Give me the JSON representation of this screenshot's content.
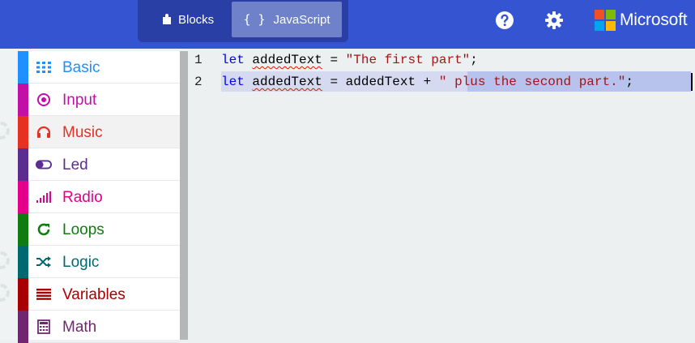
{
  "header": {
    "toggle": {
      "blocks_label": "Blocks",
      "js_label": "JavaScript",
      "js_braces": "{ }"
    },
    "help_icon": "help-circle-icon",
    "settings_icon": "gear-icon",
    "brand": "Microsoft",
    "brand_colors": [
      "#f25022",
      "#7fba00",
      "#00a4ef",
      "#ffb900"
    ]
  },
  "toolbox": {
    "categories": [
      {
        "label": "Basic",
        "color": "#1e90ff",
        "icon": "grid-icon"
      },
      {
        "label": "Input",
        "color": "#c20fa6",
        "icon": "target-icon"
      },
      {
        "label": "Music",
        "color": "#e63022",
        "icon": "headphones-icon"
      },
      {
        "label": "Led",
        "color": "#5c2d91",
        "icon": "toggle-icon"
      },
      {
        "label": "Radio",
        "color": "#e3008c",
        "icon": "signal-icon"
      },
      {
        "label": "Loops",
        "color": "#107c10",
        "icon": "refresh-icon"
      },
      {
        "label": "Logic",
        "color": "#006970",
        "icon": "shuffle-icon"
      },
      {
        "label": "Variables",
        "color": "#a80000",
        "icon": "list-icon"
      },
      {
        "label": "Math",
        "color": "#712672",
        "icon": "calculator-icon"
      }
    ]
  },
  "editor": {
    "lines": [
      {
        "num": "1",
        "kw": "let",
        "sp1": " ",
        "ident": "addedText",
        "rest": " = ",
        "str": "\"The first part\"",
        "end": ";"
      },
      {
        "num": "2",
        "kw": "let",
        "sp1": " ",
        "ident": "addedText",
        "rest": " = addedText + ",
        "str": "\" plus the second part.\"",
        "end": ";"
      }
    ]
  }
}
